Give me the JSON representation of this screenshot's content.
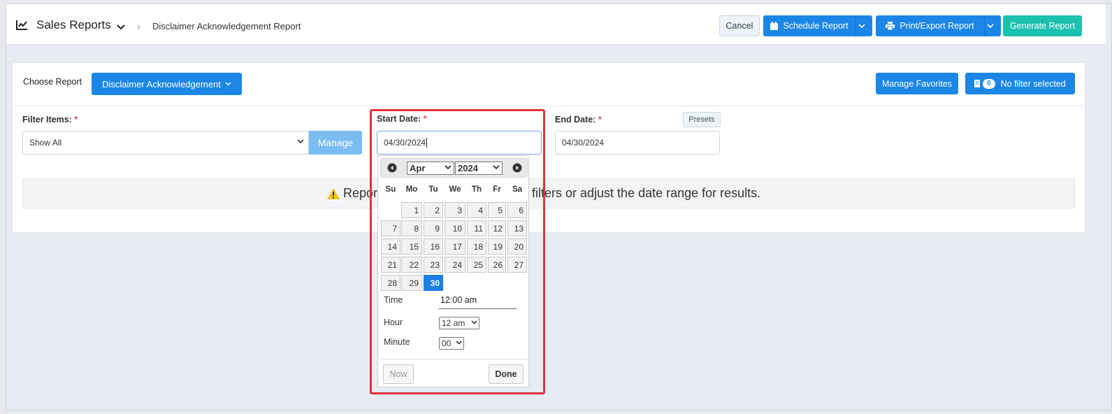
{
  "header": {
    "title": "Sales Reports",
    "breadcrumb": "Disclaimer Acknowledgement Report",
    "cancel_label": "Cancel",
    "schedule_label": "Schedule Report",
    "print_label": "Print/Export Report",
    "generate_label": "Generate Report"
  },
  "report": {
    "choose_label": "Choose Report",
    "selected_report": "Disclaimer Acknowledgement",
    "manage_favorites_label": "Manage Favorites",
    "filter_count": "0",
    "filter_status": "No filter selected"
  },
  "filters": {
    "filter_items_label": "Filter Items:",
    "required_mark": "*",
    "filter_items_value": "Show All",
    "manage_label": "Manage",
    "start_date_label": "Start Date:",
    "start_date_value": "04/30/2024",
    "end_date_label": "End Date:",
    "end_date_value": "04/30/2024",
    "presets_label": "Presets"
  },
  "alert": {
    "text_left": "Repor",
    "text_right": "filters or adjust the date range for results."
  },
  "datepicker": {
    "month": "Apr",
    "year": "2024",
    "weekdays": [
      "Su",
      "Mo",
      "Tu",
      "We",
      "Th",
      "Fr",
      "Sa"
    ],
    "weeks": [
      [
        "",
        "1",
        "2",
        "3",
        "4",
        "5",
        "6"
      ],
      [
        "7",
        "8",
        "9",
        "10",
        "11",
        "12",
        "13"
      ],
      [
        "14",
        "15",
        "16",
        "17",
        "18",
        "19",
        "20"
      ],
      [
        "21",
        "22",
        "23",
        "24",
        "25",
        "26",
        "27"
      ],
      [
        "28",
        "29",
        "30",
        "",
        "",
        "",
        ""
      ]
    ],
    "selected_day": "30",
    "time_label": "Time",
    "time_value": "12:00 am",
    "hour_label": "Hour",
    "hour_value": "12 am",
    "minute_label": "Minute",
    "minute_value": "00",
    "now_label": "Now",
    "done_label": "Done"
  },
  "colors": {
    "primary": "#1b86e6",
    "generate": "#1cc1b0",
    "highlight": "#e0333b",
    "selected_day": "#1b7fe3",
    "required": "#d9534f"
  }
}
